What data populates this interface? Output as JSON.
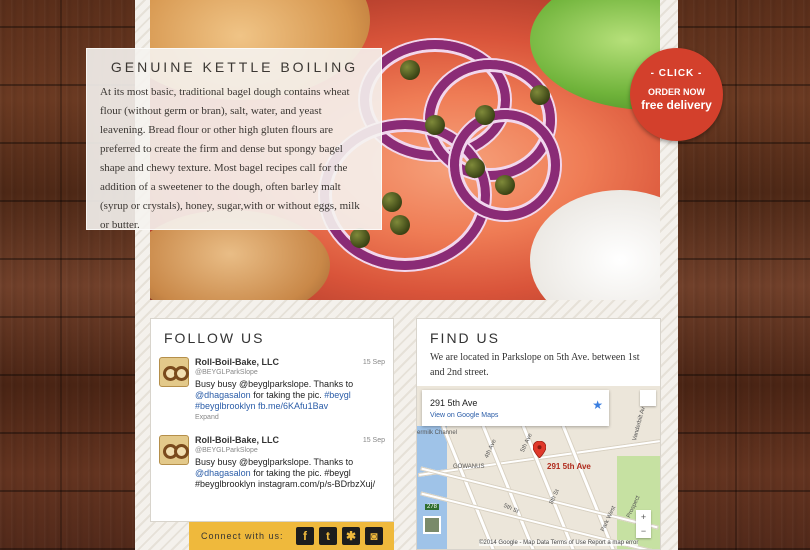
{
  "info": {
    "title": "GENUINE KETTLE BOILING",
    "body": "At its most basic, traditional bagel dough contains wheat flour (without germ or bran), salt, water, and yeast leavening. Bread flour or other high gluten flours are preferred to create the firm and dense but spongy bagel shape and chewy texture. Most bagel recipes call for the addition of a sweetener to the dough, often barley malt (syrup or crystals), honey, sugar,with or without eggs, milk or butter."
  },
  "order_badge": {
    "click": "- CLICK -",
    "order_now": "ORDER NOW",
    "free_delivery": "free delivery"
  },
  "follow": {
    "title": "FOLLOW US",
    "tweets": [
      {
        "name": "Roll-Boil-Bake, LLC",
        "handle": "@BEYGLParkSlope",
        "date": "15 Sep",
        "text_pre": "Busy busy ",
        "link1": "@beyglparkslope",
        "text_mid": ". Thanks to ",
        "link2": "@dhagasalon",
        "text_mid2": " for taking the pic. ",
        "link3": "#beygl #beyglbrooklyn fb.me/6KAfu1Bav",
        "expand": "Expand"
      },
      {
        "name": "Roll-Boil-Bake, LLC",
        "handle": "@BEYGLParkSlope",
        "date": "15 Sep",
        "text_pre": "Busy busy ",
        "link1": "@beyglparkslope",
        "text_mid": ". Thanks to ",
        "link2": "@dhagasalon",
        "text_mid2": " for taking the pic. ",
        "link3": "#beygl #beyglbrooklyn instagram.com/p/s-BDrbzXuj/"
      }
    ],
    "connect_label": "Connect with us:",
    "social_icons": [
      "facebook-icon",
      "twitter-icon",
      "yelp-icon",
      "instagram-icon"
    ]
  },
  "find": {
    "title": "FIND US",
    "text": "We are located in Parkslope on 5th Ave. between 1st and 2nd street.",
    "map": {
      "card_title": "291 5th Ave",
      "card_link": "View on Google Maps",
      "pin_label": "291 5th Ave",
      "streets": [
        "ermilk Channel",
        "5th Ave",
        "4th Ave",
        "GOWANUS",
        "5th St",
        "8th St",
        "Vanderbilt Av",
        "Park West",
        "Prospect",
        "278"
      ],
      "zoom_in": "+",
      "zoom_out": "−",
      "footer": "©2014 Google - Map Data   Terms of Use   Report a map error"
    }
  },
  "colors": {
    "badge": "#d3402c",
    "connect_bar": "#efb93c",
    "link": "#2b5da8"
  }
}
